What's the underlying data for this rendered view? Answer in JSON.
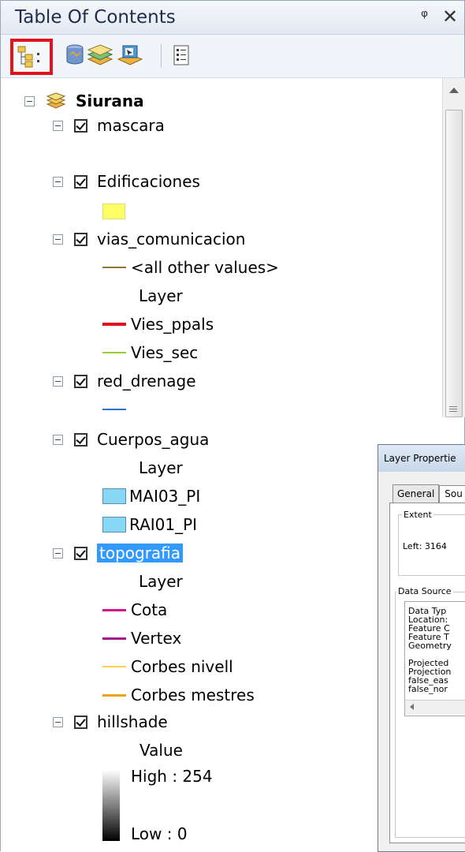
{
  "window": {
    "title": "Table Of Contents",
    "pin_glyph": "ᵠ",
    "close_glyph": "✕"
  },
  "toolbar": {
    "buttons": [
      "list-by-drawing-order-icon",
      "list-by-source-icon",
      "list-by-visibility-icon",
      "list-by-selection-icon",
      "options-icon"
    ]
  },
  "tree": {
    "root": "Siurana",
    "layers": {
      "mascara": "mascara",
      "edificaciones": "Edificaciones",
      "vias": "vias_comunicacion",
      "vias_items": [
        "<all other values>",
        "Layer",
        "Vies_ppals",
        "Vies_sec"
      ],
      "red": "red_drenage",
      "cuerpos": "Cuerpos_agua",
      "cuerpos_items": [
        "Layer",
        "MAI03_PI",
        "RAI01_PI"
      ],
      "topo": "topografia",
      "topo_items": [
        "Layer",
        "Cota",
        "Vertex",
        "Corbes nivell",
        "Corbes mestres"
      ],
      "hill": "hillshade",
      "hill_items": [
        "Value",
        "High : 254",
        "Low : 0"
      ]
    },
    "colors": {
      "edificaciones": "#ffff66",
      "all_other": "#8a7a3a",
      "vies_ppals": "#e0141b",
      "vies_sec": "#9acd32",
      "red_drenage": "#2f6fd0",
      "water": "#87d7f5",
      "cota": "#d4148c",
      "vertex": "#a0148c",
      "corbes_nivell": "#ffd24d",
      "corbes_mestres": "#e8a317",
      "selection": "#3399ff"
    }
  },
  "dialog": {
    "title": "Layer Propertie",
    "tabs": [
      "General",
      "Sou"
    ],
    "extent_label": "Extent",
    "left_value": "Left: 3164",
    "data_source_label": "Data Source",
    "source_lines": [
      "Data Typ",
      "Location:",
      "Feature C",
      "Feature T",
      "Geometry",
      "",
      "Projected",
      "Projection",
      "false_eas",
      "false_nor"
    ]
  }
}
